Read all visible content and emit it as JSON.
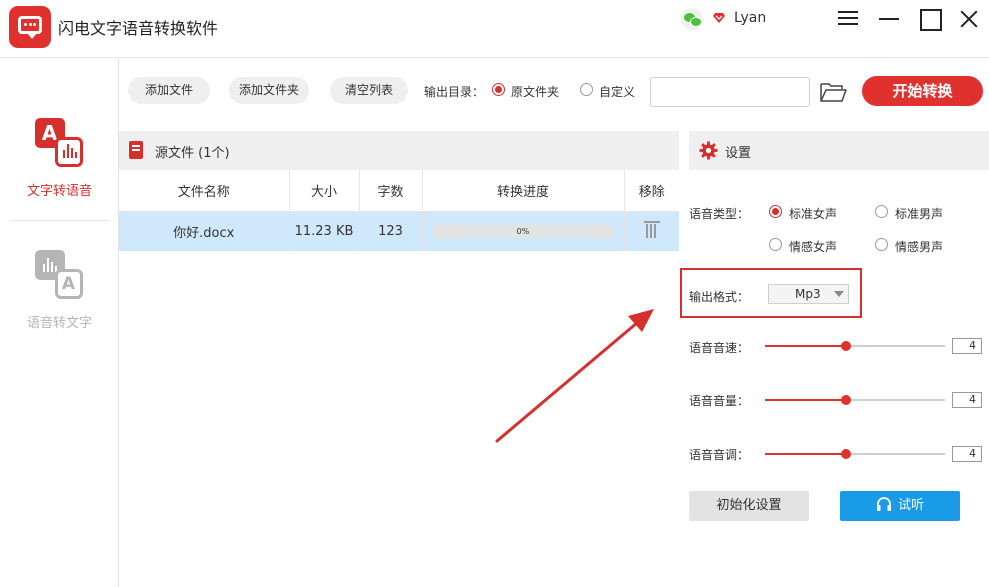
{
  "app": {
    "title": "闪电文字语音转换软件",
    "username": "Lyan",
    "accent": "#e0312f"
  },
  "sidebar": {
    "items": [
      {
        "label": "文字转语音",
        "icon": "text-to-speech-icon",
        "active": true
      },
      {
        "label": "语音转文字",
        "icon": "speech-to-text-icon",
        "active": false
      }
    ]
  },
  "toolbar": {
    "add_file": "添加文件",
    "add_folder": "添加文件夹",
    "clear_list": "清空列表",
    "output_dir_label": "输出目录：",
    "option_source_folder": "原文件夹",
    "option_custom": "自定义",
    "output_path": "",
    "start_button": "开始转换"
  },
  "files": {
    "title": "源文件 (1个)",
    "columns": [
      "文件名称",
      "大小",
      "字数",
      "转换进度",
      "移除"
    ],
    "rows": [
      {
        "name": "你好.docx",
        "size": "11.23 KB",
        "chars": "123",
        "progress": "0%",
        "progress_value": 0
      }
    ]
  },
  "settings": {
    "title": "设置",
    "voice_type_label": "语音类型：",
    "voice_options": [
      {
        "label": "标准女声",
        "selected": true
      },
      {
        "label": "标准男声",
        "selected": false
      },
      {
        "label": "情感女声",
        "selected": false
      },
      {
        "label": "情感男声",
        "selected": false
      }
    ],
    "output_format_label": "输出格式：",
    "output_format": "Mp3",
    "speed_label": "语音音速：",
    "speed_value": "4",
    "speed_level": 0.45,
    "volume_label": "语音音量：",
    "volume_value": "4",
    "volume_level": 0.45,
    "pitch_label": "语音音调：",
    "pitch_value": "4",
    "pitch_level": 0.45,
    "reset_button": "初始化设置",
    "listen_button": "试听",
    "listen_color": "#1a9be8"
  }
}
